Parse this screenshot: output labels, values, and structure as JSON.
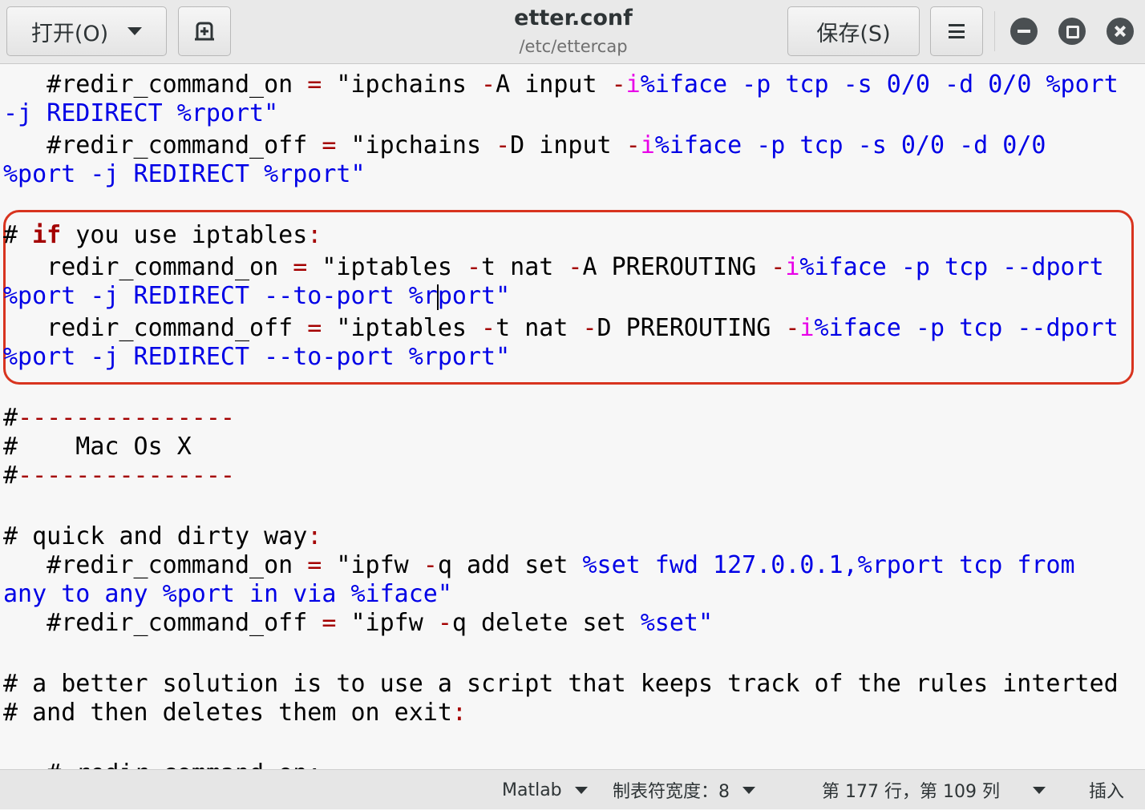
{
  "header": {
    "open_label": "打开(O)",
    "title": "etter.conf",
    "subtitle": "/etc/ettercap",
    "save_label": "保存(S)"
  },
  "editor": {
    "lines": [
      [
        {
          "c": "   #redir_command_on "
        },
        {
          "c": "=",
          "s": "op"
        },
        {
          "c": " \"ipchains "
        },
        {
          "c": "-",
          "s": "op"
        },
        {
          "c": "A input "
        },
        {
          "c": "-",
          "s": "op"
        },
        {
          "c": "i",
          "s": "mg"
        },
        {
          "c": "%iface -p tcp -s 0/0 -d 0/0 %port",
          "s": "bl"
        }
      ],
      [
        {
          "c": "-j REDIRECT %rport\"",
          "s": "bl"
        }
      ],
      [
        {
          "c": "   #redir_command_off "
        },
        {
          "c": "=",
          "s": "op"
        },
        {
          "c": " \"ipchains "
        },
        {
          "c": "-",
          "s": "op"
        },
        {
          "c": "D input "
        },
        {
          "c": "-",
          "s": "op"
        },
        {
          "c": "i",
          "s": "mg"
        },
        {
          "c": "%iface -p tcp -s 0/0 -d 0/0",
          "s": "bl"
        }
      ],
      [
        {
          "c": "%port -j REDIRECT %rport\"",
          "s": "bl"
        }
      ],
      [],
      [
        {
          "c": "# "
        },
        {
          "c": "if",
          "s": "kw"
        },
        {
          "c": " you use iptables"
        },
        {
          "c": ":",
          "s": "op"
        }
      ],
      [
        {
          "c": "   redir_command_on "
        },
        {
          "c": "=",
          "s": "op"
        },
        {
          "c": " \"iptables "
        },
        {
          "c": "-",
          "s": "op"
        },
        {
          "c": "t nat "
        },
        {
          "c": "-",
          "s": "op"
        },
        {
          "c": "A PREROUTING "
        },
        {
          "c": "-",
          "s": "op"
        },
        {
          "c": "i",
          "s": "mg"
        },
        {
          "c": "%iface -p tcp --dport",
          "s": "bl"
        }
      ],
      [
        {
          "c": "%port -j REDIRECT --to-port %r",
          "s": "bl"
        },
        {
          "cursor": true
        },
        {
          "c": "port\"",
          "s": "bl"
        }
      ],
      [
        {
          "c": "   redir_command_off "
        },
        {
          "c": "=",
          "s": "op"
        },
        {
          "c": " \"iptables "
        },
        {
          "c": "-",
          "s": "op"
        },
        {
          "c": "t nat "
        },
        {
          "c": "-",
          "s": "op"
        },
        {
          "c": "D PREROUTING "
        },
        {
          "c": "-",
          "s": "op"
        },
        {
          "c": "i",
          "s": "mg"
        },
        {
          "c": "%iface -p tcp --dport",
          "s": "bl"
        }
      ],
      [
        {
          "c": "%port -j REDIRECT --to-port %rport\"",
          "s": "bl"
        }
      ],
      [],
      [
        {
          "c": "#"
        },
        {
          "c": "---------------",
          "s": "op"
        }
      ],
      [
        {
          "c": "#    Mac Os X"
        }
      ],
      [
        {
          "c": "#"
        },
        {
          "c": "---------------",
          "s": "op"
        }
      ],
      [],
      [
        {
          "c": "# quick and dirty way"
        },
        {
          "c": ":",
          "s": "op"
        }
      ],
      [
        {
          "c": "   #redir_command_on "
        },
        {
          "c": "=",
          "s": "op"
        },
        {
          "c": " \"ipfw "
        },
        {
          "c": "-",
          "s": "op"
        },
        {
          "c": "q add set "
        },
        {
          "c": "%set fwd 127.0.0.1,%rport tcp from",
          "s": "bl"
        }
      ],
      [
        {
          "c": "any to any %port in via %iface\"",
          "s": "bl"
        }
      ],
      [
        {
          "c": "   #redir_command_off "
        },
        {
          "c": "=",
          "s": "op"
        },
        {
          "c": " \"ipfw "
        },
        {
          "c": "-",
          "s": "op"
        },
        {
          "c": "q delete set "
        },
        {
          "c": "%set\"",
          "s": "bl"
        }
      ],
      [],
      [
        {
          "c": "# a better solution is to use a script that keeps track of the rules interted"
        }
      ],
      [
        {
          "c": "# and then deletes them on exit"
        },
        {
          "c": ":",
          "s": "op"
        }
      ],
      [],
      [
        {
          "c": "   # redir_command_on:"
        }
      ]
    ]
  },
  "statusbar": {
    "language": "Matlab",
    "tab_width": "制表符宽度：8",
    "position": "第 177 行，第 109 列",
    "mode": "插入"
  },
  "icons": {
    "open_dropdown": "chevron-down-icon",
    "new_tab": "new-document-icon",
    "menu": "hamburger-menu-icon",
    "minimize": "minimize-icon",
    "maximize": "maximize-icon",
    "close": "close-icon"
  },
  "colors": {
    "keyword": "#a40000",
    "operator": "#a40000",
    "variable_i": "#e800e8",
    "string": "#0000e6",
    "highlight_box": "#d8341f"
  }
}
